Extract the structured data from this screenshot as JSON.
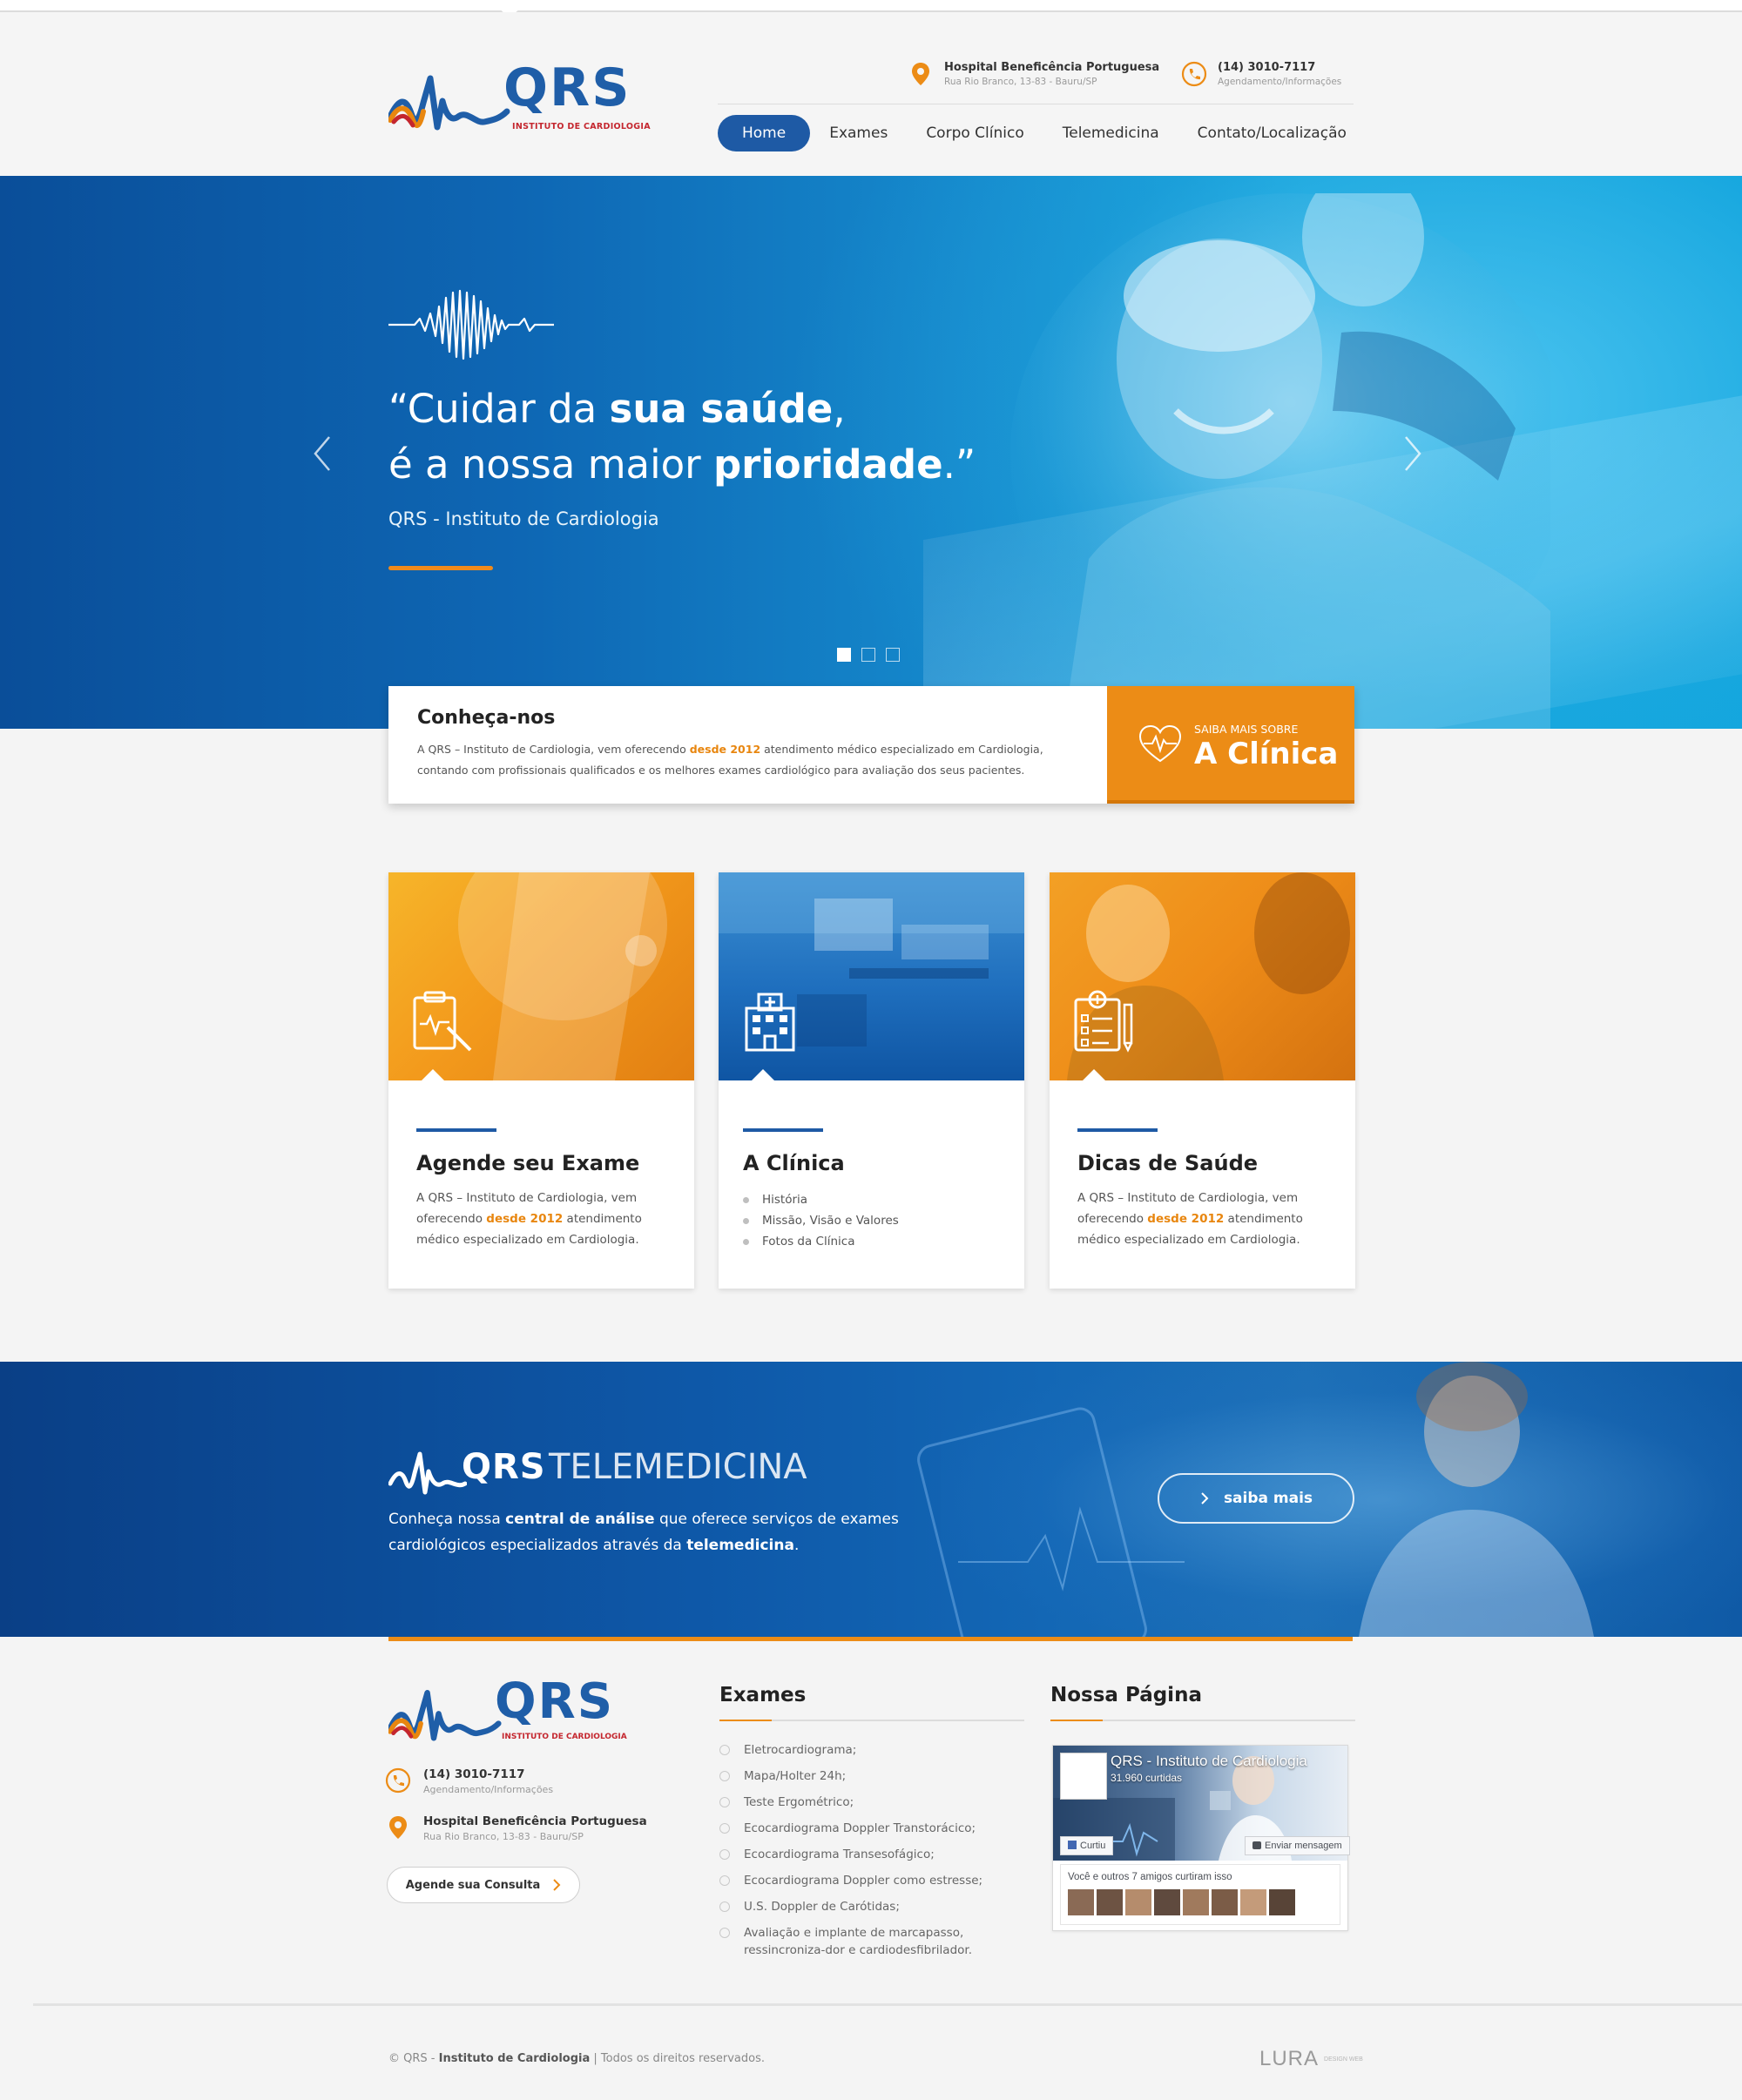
{
  "brand": {
    "name": "QRS",
    "subtitle": "INSTITUTO DE CARDIOLOGIA"
  },
  "header": {
    "address": {
      "title": "Hospital Beneficência Portuguesa",
      "line": "Rua Rio Branco, 13-83 - Bauru/SP",
      "icon": "location-pin-icon"
    },
    "phone": {
      "number": "(14) 3010-7117",
      "note": "Agendamento/Informações",
      "icon": "phone-icon"
    },
    "nav": [
      {
        "label": "Home",
        "active": true
      },
      {
        "label": "Exames"
      },
      {
        "label": "Corpo Clínico"
      },
      {
        "label": "Telemedicina"
      },
      {
        "label": "Contato/Localização"
      }
    ]
  },
  "hero": {
    "quote_open": "“Cuidar da ",
    "quote_bold1": "sua saúde",
    "quote_mid": ",",
    "quote_line2": "é a nossa maior ",
    "quote_bold2": "prioridade",
    "quote_close": ".”",
    "author": "QRS - Instituto de Cardiologia",
    "slides_total": 3,
    "slide_active": 1
  },
  "about": {
    "title": "Conheça-nos",
    "text_before": "A QRS – Instituto de Cardiologia, vem oferecendo ",
    "text_highlight": "desde 2012",
    "text_after": " atendimento médico especializado em Cardiologia, contando com profissionais qualificados e os melhores exames cardiológico para avaliação dos seus pacientes.",
    "cta_small": "SAIBA MAIS SOBRE",
    "cta_big": "A Clínica"
  },
  "cards": [
    {
      "title": "Agende seu Exame",
      "text_before": "A QRS – Instituto de Cardiologia, vem oferecendo ",
      "text_highlight": "desde 2012",
      "text_after": " atendimento médico especializado em Cardiologia.",
      "icon": "clipboard-ecg-icon"
    },
    {
      "title": "A Clínica",
      "items": [
        "História",
        "Missão, Visão e Valores",
        "Fotos da Clínica"
      ],
      "icon": "hospital-building-icon"
    },
    {
      "title": "Dicas de Saúde",
      "text_before": "A QRS – Instituto de Cardiologia, vem oferecendo ",
      "text_highlight": "desde 2012",
      "text_after": " atendimento médico especializado em Cardiologia.",
      "icon": "medical-checklist-icon"
    }
  ],
  "telemedicina": {
    "logo_qrs": "QRS",
    "logo_word": "TELEMEDICINA",
    "text_before": "Conheça nossa ",
    "text_bold1": "central de análise",
    "text_mid": " que oferece serviços de exames cardiológicos especializados através da ",
    "text_bold2": "telemedicina",
    "text_after": ".",
    "button": "saiba mais"
  },
  "footer": {
    "phone": "(14) 3010-7117",
    "phone_note": "Agendamento/Informações",
    "address_title": "Hospital Beneficência Portuguesa",
    "address_line": "Rua Rio Branco, 13-83 - Bauru/SP",
    "agende_button": "Agende sua Consulta",
    "exames_title": "Exames",
    "exames": [
      "Eletrocardiograma;",
      "Mapa/Holter 24h;",
      "Teste Ergométrico;",
      "Ecocardiograma Doppler Transtorácico;",
      "Ecocardiograma Transesofágico;",
      "Ecocardiograma Doppler como estresse;",
      "U.S. Doppler de Carótidas;",
      "Avaliação e implante de marcapasso, ressincroniza-dor e cardiodesfibrilador."
    ],
    "pagina_title": "Nossa Página",
    "fb": {
      "page_name": "QRS - Instituto de Cardiologia",
      "likes": "31.960 curtidas",
      "liked_button": "Curtiu",
      "message_button": "Enviar mensagem",
      "friends_text": "Você e outros 7 amigos curtiram isso"
    },
    "copyright_pre": "© QRS - ",
    "copyright_bold": "Instituto de Cardiologia",
    "copyright_post": " | Todos os direitos reservados.",
    "agency": "LURA",
    "agency_note": "DESIGN WEB"
  },
  "colors": {
    "primary_blue": "#1e5aa5",
    "accent_orange": "#ec8c16",
    "logo_red": "#c4262e"
  }
}
